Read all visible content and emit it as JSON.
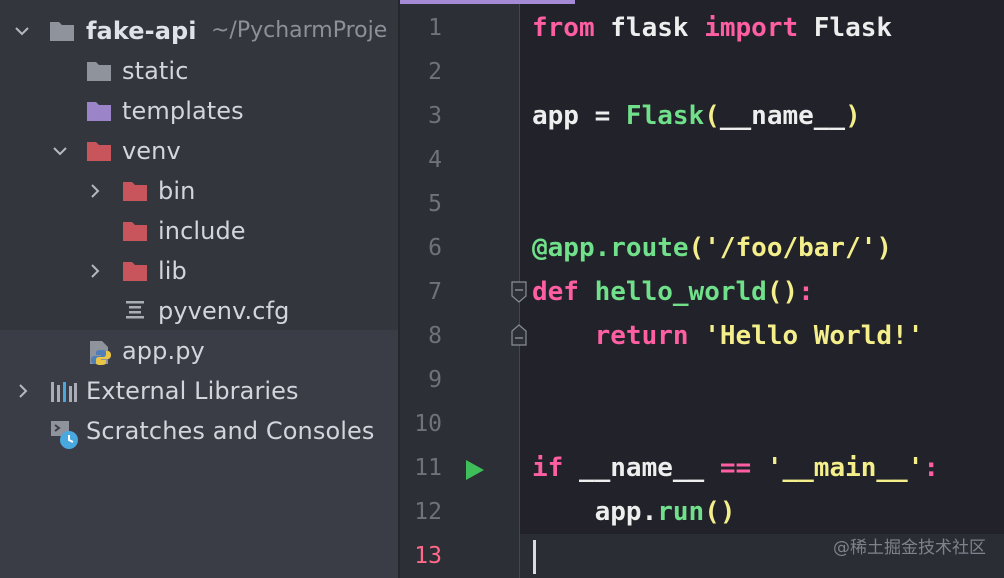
{
  "project_tree": {
    "project_name": "fake-api",
    "project_path": "~/PycharmProje",
    "items": [
      {
        "label": "static",
        "icon": "folder-icon",
        "color": "#8f939b"
      },
      {
        "label": "templates",
        "icon": "folder-icon",
        "color": "#9b84c8"
      },
      {
        "label": "venv",
        "icon": "folder-icon",
        "color": "#c8555c"
      },
      {
        "label": "bin",
        "icon": "folder-icon",
        "color": "#c8555c"
      },
      {
        "label": "include",
        "icon": "folder-icon",
        "color": "#c8555c"
      },
      {
        "label": "lib",
        "icon": "folder-icon",
        "color": "#c8555c"
      },
      {
        "label": "pyvenv.cfg",
        "icon": "config-file-icon"
      },
      {
        "label": "app.py",
        "icon": "python-file-icon"
      },
      {
        "label": "External Libraries",
        "icon": "library-icon"
      },
      {
        "label": "Scratches and Consoles",
        "icon": "scratches-icon"
      }
    ]
  },
  "editor": {
    "line_numbers": [
      "1",
      "2",
      "3",
      "4",
      "5",
      "6",
      "7",
      "8",
      "9",
      "10",
      "11",
      "12",
      "13"
    ],
    "current_line": "13",
    "code": {
      "l1": {
        "kw1": "from",
        "mod": " flask ",
        "kw2": "import",
        "name": " Flask"
      },
      "l3": {
        "var": "app = ",
        "fn": "Flask",
        "open": "(",
        "arg": "__name__",
        "close": ")"
      },
      "l6": {
        "dec": "@app.route",
        "open": "(",
        "str": "'/foo/bar/'",
        "close": ")"
      },
      "l7": {
        "kw": "def",
        "sp": " ",
        "fn": "hello_world",
        "open": "(",
        "close": ")",
        "colon": ":"
      },
      "l8": {
        "indent": "    ",
        "kw": "return",
        "sp": " ",
        "str": "'Hello World!'"
      },
      "l11": {
        "kw": "if",
        "mid": " __name__ ",
        "op": "==",
        "sp": " ",
        "str": "'__main__'",
        "colon": ":"
      },
      "l12": {
        "indent": "    ",
        "obj": "app.",
        "fn": "run",
        "open": "(",
        "close": ")"
      }
    }
  },
  "watermark": "@稀土掘金技术社区",
  "colors": {
    "keyword": "#ff5fa2",
    "function": "#70e08a",
    "string": "#f4ef8a",
    "accent": "#a58ad6"
  }
}
